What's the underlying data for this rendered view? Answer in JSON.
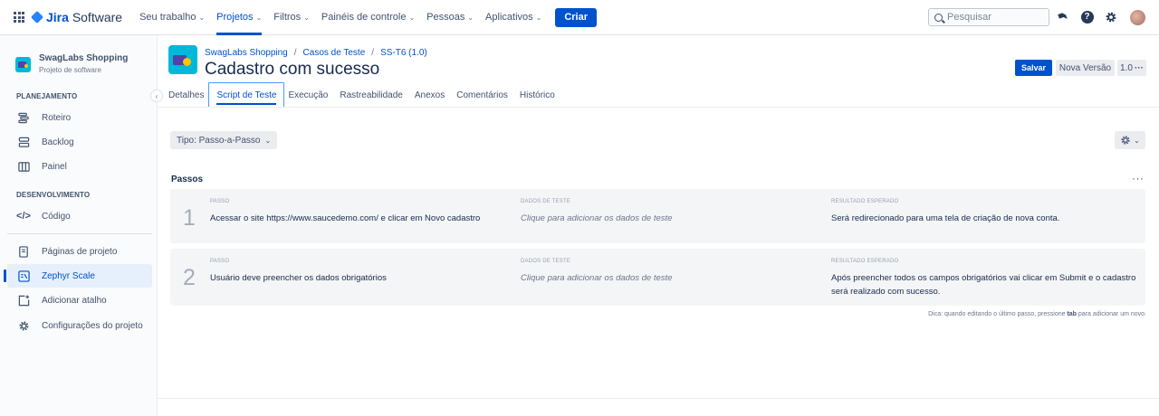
{
  "topnav": {
    "logo_brand": "Jira",
    "logo_product": "Software",
    "items": [
      {
        "label": "Seu trabalho",
        "active": false
      },
      {
        "label": "Projetos",
        "active": true
      },
      {
        "label": "Filtros",
        "active": false
      },
      {
        "label": "Painéis de controle",
        "active": false
      },
      {
        "label": "Pessoas",
        "active": false
      },
      {
        "label": "Aplicativos",
        "active": false
      }
    ],
    "create_label": "Criar",
    "search_placeholder": "Pesquisar",
    "icons": [
      "notification-icon",
      "help-icon",
      "settings-icon",
      "avatar"
    ]
  },
  "sidebar": {
    "project_name": "SwagLabs Shopping",
    "project_type": "Projeto de software",
    "planning_label": "PLANEJAMENTO",
    "planning_items": [
      {
        "label": "Roteiro",
        "icon": "roadmap-icon"
      },
      {
        "label": "Backlog",
        "icon": "backlog-icon"
      },
      {
        "label": "Painel",
        "icon": "board-icon"
      }
    ],
    "dev_label": "DESENVOLVIMENTO",
    "dev_items": [
      {
        "label": "Código",
        "icon": "code-icon"
      }
    ],
    "other_items": [
      {
        "label": "Páginas de projeto",
        "icon": "pages-icon",
        "active": false
      },
      {
        "label": "Zephyr Scale",
        "icon": "zephyr-icon",
        "active": true
      },
      {
        "label": "Adicionar atalho",
        "icon": "add-shortcut-icon",
        "active": false
      },
      {
        "label": "Configurações do projeto",
        "icon": "settings-icon",
        "active": false
      }
    ]
  },
  "header": {
    "breadcrumb": [
      "SwagLabs Shopping",
      "Casos de Teste",
      "SS-T6 (1.0)"
    ],
    "title": "Cadastro com sucesso",
    "save_label": "Salvar",
    "new_version_label": "Nova Versão",
    "version_label": "1.0",
    "tabs": [
      {
        "label": "Detalhes",
        "active": false
      },
      {
        "label": "Script de Teste",
        "active": true
      },
      {
        "label": "Execução",
        "active": false
      },
      {
        "label": "Rastreabilidade",
        "active": false
      },
      {
        "label": "Anexos",
        "active": false
      },
      {
        "label": "Comentários",
        "active": false
      },
      {
        "label": "Histórico",
        "active": false
      }
    ]
  },
  "script": {
    "type_label": "Tipo: Passo-a-Passo",
    "steps_title": "Passos",
    "col_step": "PASSO",
    "col_data": "DADOS DE TESTE",
    "col_result": "RESULTADO ESPERADO",
    "steps": [
      {
        "number": "1",
        "step": "Acessar o site https://www.saucedemo.com/ e clicar em Novo cadastro",
        "data": "Clique para adicionar os dados de teste",
        "result": "Será redirecionado para uma tela de criação de nova conta."
      },
      {
        "number": "2",
        "step": "Usuário deve preencher os dados obrigatórios",
        "data": "Clique para adicionar os dados de teste",
        "result": "Após preencher todos os campos obrigatórios vai clicar em Submit e o cadastro será realizado com sucesso."
      }
    ],
    "tip_prefix": "Dica: quando editando o último passo, pressione ",
    "tip_key": "tab",
    "tip_suffix": " para adicionar um novo."
  }
}
